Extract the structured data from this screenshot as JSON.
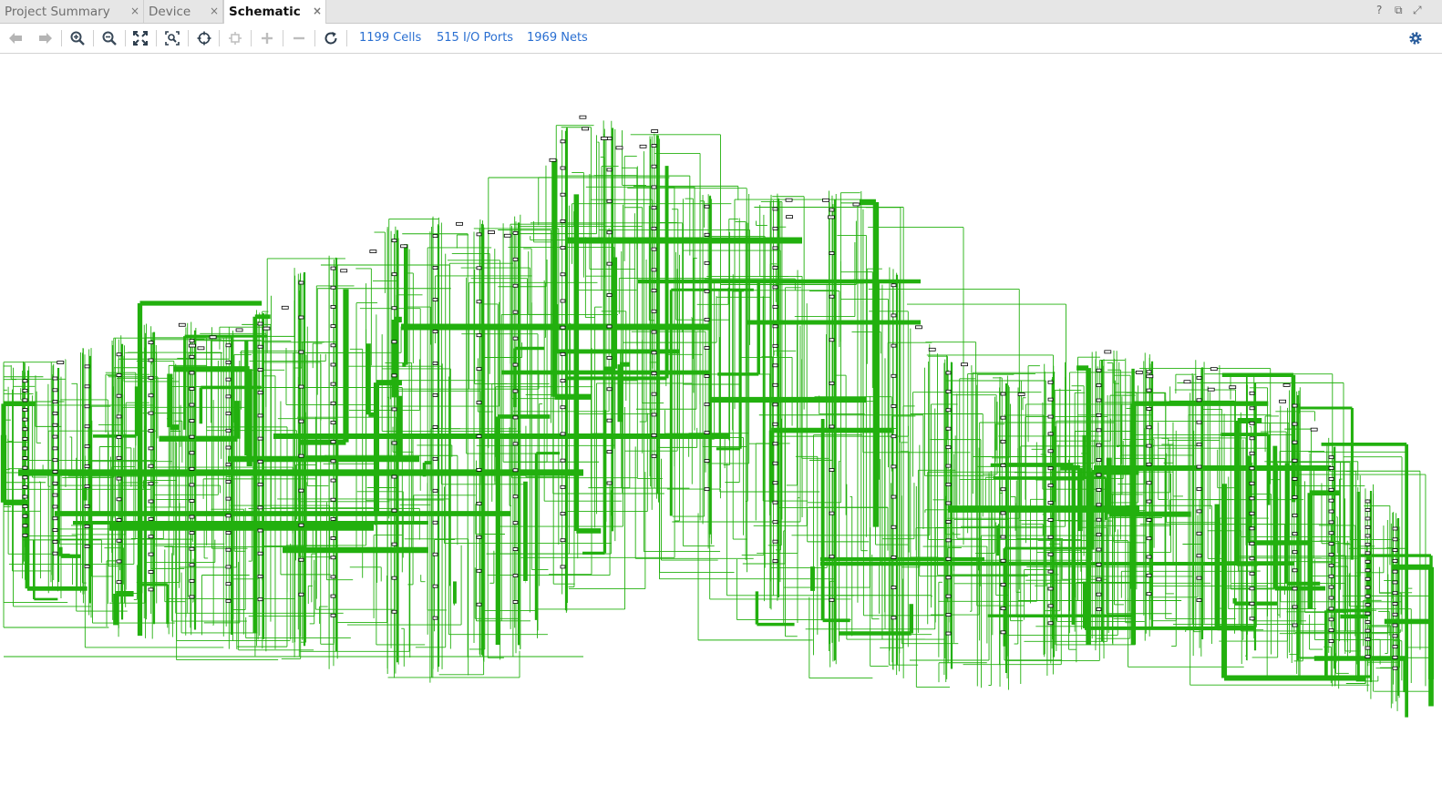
{
  "tabs": [
    {
      "label": "Project Summary",
      "close": "×",
      "active": false
    },
    {
      "label": "Device",
      "close": "×",
      "active": false
    },
    {
      "label": "Schematic",
      "close": "×",
      "active": true
    }
  ],
  "window_controls": [
    "?",
    "⧉",
    "⤢"
  ],
  "toolbar": {
    "icons": [
      "back-arrow-icon",
      "forward-arrow-icon",
      "zoom-in-icon",
      "zoom-out-icon",
      "zoom-fit-icon",
      "zoom-area-icon",
      "crosshair-icon",
      "collapse-icon",
      "expand-plus-icon",
      "collapse-minus-icon",
      "refresh-icon"
    ],
    "stats": {
      "cells": "1199 Cells",
      "ports": "515 I/O Ports",
      "nets": "1969 Nets"
    },
    "settings_icon": "gear-icon"
  },
  "schematic": {
    "net_color": "#22b00e",
    "cell_color": "#000000"
  }
}
